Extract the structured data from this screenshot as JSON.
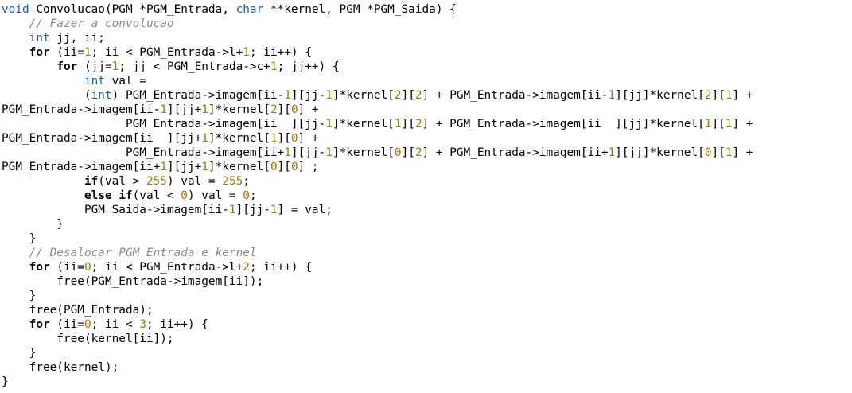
{
  "editor": {
    "colors": {
      "background": "#ffffff",
      "type": "#1a5fa8",
      "keyword": "#000000",
      "number": "#a47a00",
      "comment": "#8a8a8a",
      "text": "#000000"
    },
    "lines": [
      [
        [
          "t",
          "void"
        ],
        [
          "p",
          " Convolucao(PGM *PGM_Entrada, "
        ],
        [
          "t",
          "char"
        ],
        [
          "p",
          " **kernel, PGM *PGM_Saida) {"
        ]
      ],
      [
        [
          "p",
          "    "
        ],
        [
          "c",
          "// Fazer a convolucao"
        ]
      ],
      [
        [
          "p",
          "    "
        ],
        [
          "t",
          "int"
        ],
        [
          "p",
          " jj, ii;"
        ]
      ],
      [
        [
          "p",
          "    "
        ],
        [
          "k",
          "for"
        ],
        [
          "p",
          " (ii="
        ],
        [
          "n",
          "1"
        ],
        [
          "p",
          "; ii < PGM_Entrada->l+"
        ],
        [
          "n",
          "1"
        ],
        [
          "p",
          "; ii++) {"
        ]
      ],
      [
        [
          "p",
          "        "
        ],
        [
          "k",
          "for"
        ],
        [
          "p",
          " (jj="
        ],
        [
          "n",
          "1"
        ],
        [
          "p",
          "; jj < PGM_Entrada->c+"
        ],
        [
          "n",
          "1"
        ],
        [
          "p",
          "; jj++) {"
        ]
      ],
      [
        [
          "p",
          "            "
        ],
        [
          "t",
          "int"
        ],
        [
          "p",
          " val ="
        ]
      ],
      [
        [
          "p",
          "            ("
        ],
        [
          "t",
          "int"
        ],
        [
          "p",
          ") PGM_Entrada->imagem[ii-"
        ],
        [
          "n",
          "1"
        ],
        [
          "p",
          "][jj-"
        ],
        [
          "n",
          "1"
        ],
        [
          "p",
          "]*kernel["
        ],
        [
          "n",
          "2"
        ],
        [
          "p",
          "]["
        ],
        [
          "n",
          "2"
        ],
        [
          "p",
          "] + PGM_Entrada->imagem[ii-"
        ],
        [
          "n",
          "1"
        ],
        [
          "p",
          "][jj]*kernel["
        ],
        [
          "n",
          "2"
        ],
        [
          "p",
          "]["
        ],
        [
          "n",
          "1"
        ],
        [
          "p",
          "] +"
        ]
      ],
      [
        [
          "p",
          "PGM_Entrada->imagem[ii-"
        ],
        [
          "n",
          "1"
        ],
        [
          "p",
          "][jj+"
        ],
        [
          "n",
          "1"
        ],
        [
          "p",
          "]*kernel["
        ],
        [
          "n",
          "2"
        ],
        [
          "p",
          "]["
        ],
        [
          "n",
          "0"
        ],
        [
          "p",
          "] +"
        ]
      ],
      [
        [
          "p",
          "                  PGM_Entrada->imagem[ii  ][jj-"
        ],
        [
          "n",
          "1"
        ],
        [
          "p",
          "]*kernel["
        ],
        [
          "n",
          "1"
        ],
        [
          "p",
          "]["
        ],
        [
          "n",
          "2"
        ],
        [
          "p",
          "] + PGM_Entrada->imagem[ii  ][jj]*kernel["
        ],
        [
          "n",
          "1"
        ],
        [
          "p",
          "]["
        ],
        [
          "n",
          "1"
        ],
        [
          "p",
          "] +"
        ]
      ],
      [
        [
          "p",
          "PGM_Entrada->imagem[ii  ][jj+"
        ],
        [
          "n",
          "1"
        ],
        [
          "p",
          "]*kernel["
        ],
        [
          "n",
          "1"
        ],
        [
          "p",
          "]["
        ],
        [
          "n",
          "0"
        ],
        [
          "p",
          "] +"
        ]
      ],
      [
        [
          "p",
          "                  PGM_Entrada->imagem[ii+"
        ],
        [
          "n",
          "1"
        ],
        [
          "p",
          "][jj-"
        ],
        [
          "n",
          "1"
        ],
        [
          "p",
          "]*kernel["
        ],
        [
          "n",
          "0"
        ],
        [
          "p",
          "]["
        ],
        [
          "n",
          "2"
        ],
        [
          "p",
          "] + PGM_Entrada->imagem[ii+"
        ],
        [
          "n",
          "1"
        ],
        [
          "p",
          "][jj]*kernel["
        ],
        [
          "n",
          "0"
        ],
        [
          "p",
          "]["
        ],
        [
          "n",
          "1"
        ],
        [
          "p",
          "] +"
        ]
      ],
      [
        [
          "p",
          "PGM_Entrada->imagem[ii+"
        ],
        [
          "n",
          "1"
        ],
        [
          "p",
          "][jj+"
        ],
        [
          "n",
          "1"
        ],
        [
          "p",
          "]*kernel["
        ],
        [
          "n",
          "0"
        ],
        [
          "p",
          "]["
        ],
        [
          "n",
          "0"
        ],
        [
          "p",
          "] ;"
        ]
      ],
      [
        [
          "p",
          "            "
        ],
        [
          "k",
          "if"
        ],
        [
          "p",
          "(val > "
        ],
        [
          "n",
          "255"
        ],
        [
          "p",
          ") val = "
        ],
        [
          "n",
          "255"
        ],
        [
          "p",
          ";"
        ]
      ],
      [
        [
          "p",
          "            "
        ],
        [
          "k",
          "else if"
        ],
        [
          "p",
          "(val < "
        ],
        [
          "n",
          "0"
        ],
        [
          "p",
          ") val = "
        ],
        [
          "n",
          "0"
        ],
        [
          "p",
          ";"
        ]
      ],
      [
        [
          "p",
          "            PGM_Saida->imagem[ii-"
        ],
        [
          "n",
          "1"
        ],
        [
          "p",
          "][jj-"
        ],
        [
          "n",
          "1"
        ],
        [
          "p",
          "] = val;"
        ]
      ],
      [
        [
          "p",
          "        }"
        ]
      ],
      [
        [
          "p",
          "    }"
        ]
      ],
      [
        [
          "p",
          "    "
        ],
        [
          "c",
          "// Desalocar PGM_Entrada e kernel"
        ]
      ],
      [
        [
          "p",
          "    "
        ],
        [
          "k",
          "for"
        ],
        [
          "p",
          " (ii="
        ],
        [
          "n",
          "0"
        ],
        [
          "p",
          "; ii < PGM_Entrada->l+"
        ],
        [
          "n",
          "2"
        ],
        [
          "p",
          "; ii++) {"
        ]
      ],
      [
        [
          "p",
          "        free(PGM_Entrada->imagem[ii]);"
        ]
      ],
      [
        [
          "p",
          "    }"
        ]
      ],
      [
        [
          "p",
          "    free(PGM_Entrada);"
        ]
      ],
      [
        [
          "p",
          "    "
        ],
        [
          "k",
          "for"
        ],
        [
          "p",
          " (ii="
        ],
        [
          "n",
          "0"
        ],
        [
          "p",
          "; ii < "
        ],
        [
          "n",
          "3"
        ],
        [
          "p",
          "; ii++) {"
        ]
      ],
      [
        [
          "p",
          "        free(kernel[ii]);"
        ]
      ],
      [
        [
          "p",
          "    }"
        ]
      ],
      [
        [
          "p",
          "    free(kernel);"
        ]
      ],
      [
        [
          "p",
          "}"
        ]
      ]
    ]
  }
}
